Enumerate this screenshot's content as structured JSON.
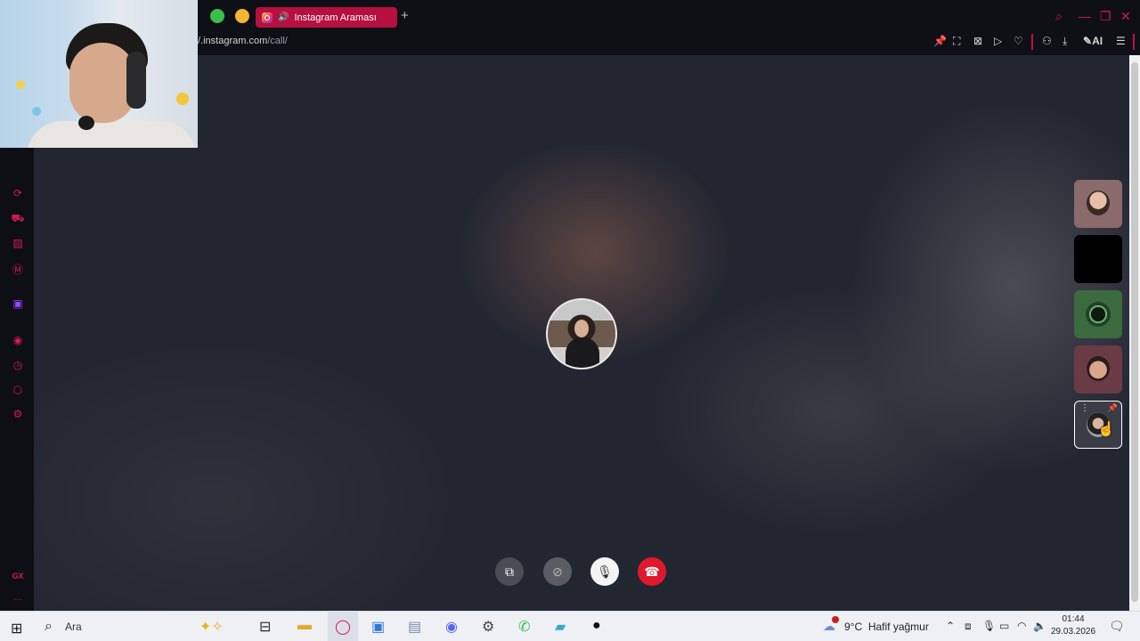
{
  "browser": {
    "active_tab_title": "Instagram Araması",
    "new_tab_icon": "plus-icon",
    "url_host": "/.instagram.com",
    "url_path": "/call/",
    "ai_label": "AI",
    "accent": "#b5103f"
  },
  "sidebar": {
    "icons": [
      "aria-icon",
      "shopping-icon",
      "pinboard-icon",
      "messenger-icon",
      "twitch-icon",
      "player-icon",
      "history-icon",
      "extensions-icon",
      "settings-icon"
    ],
    "gx_label": "GX",
    "more_label": "···"
  },
  "call": {
    "controls": [
      "share-screen",
      "camera-off",
      "microphone",
      "end-call"
    ],
    "end_call_color": "#e0182d"
  },
  "taskbar": {
    "search_placeholder": "Ara",
    "weather_temp": "9°C",
    "weather_text": "Hafif yağmur",
    "time": "01:44",
    "date": "29.03.2026"
  }
}
